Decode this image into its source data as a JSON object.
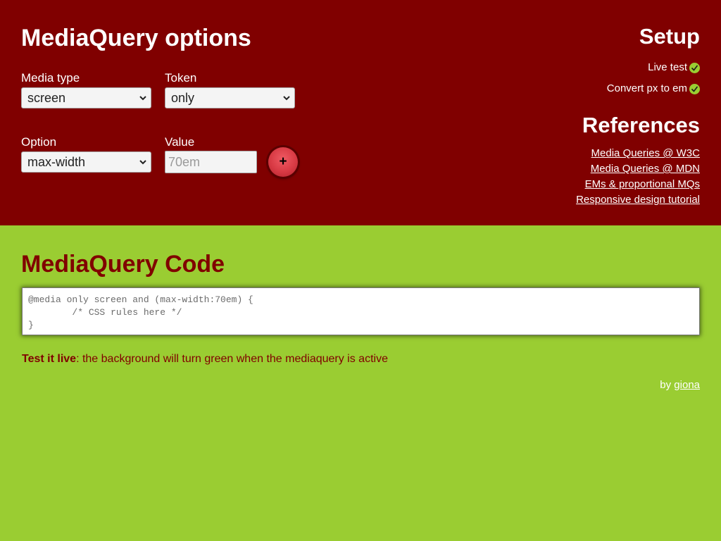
{
  "options": {
    "title": "MediaQuery options",
    "media_type": {
      "label": "Media type",
      "value": "screen"
    },
    "token": {
      "label": "Token",
      "value": "only"
    },
    "option": {
      "label": "Option",
      "value": "max-width"
    },
    "value": {
      "label": "Value",
      "placeholder": "70em"
    },
    "add_button": "+"
  },
  "setup": {
    "title": "Setup",
    "items": [
      {
        "label": "Live test",
        "icon": "check-icon"
      },
      {
        "label": "Convert px to em",
        "icon": "check-icon"
      }
    ]
  },
  "references": {
    "title": "References",
    "links": [
      "Media Queries @ W3C",
      "Media Queries @ MDN",
      "EMs & proportional MQs",
      "Responsive design tutorial"
    ]
  },
  "code": {
    "title": "MediaQuery Code",
    "text": "@media only screen and (max-width:70em) {\n        /* CSS rules here */\n}"
  },
  "test": {
    "strong": "Test it live",
    "rest": ": the background will turn green when the mediaquery is active"
  },
  "byline": {
    "prefix": "by ",
    "author": "giona"
  },
  "colors": {
    "header_bg": "#800000",
    "body_bg": "#9acd32",
    "accent_button": "#d83a44"
  }
}
